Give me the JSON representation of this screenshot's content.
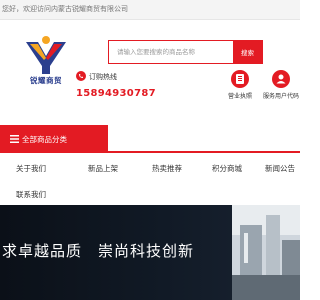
{
  "topbar": {
    "welcome": "您好，欢迎访问内蒙古锐耀商贸有限公司"
  },
  "logo": {
    "text": "锐耀商贸",
    "icon": "ry-logo-icon"
  },
  "search": {
    "placeholder": "请输入您要搜索的商品名称",
    "button_label": "搜索"
  },
  "hotline": {
    "label": "订购热线",
    "number": "15894930787",
    "icon": "phone-icon"
  },
  "badges": [
    {
      "label": "营业执照",
      "icon": "license-icon"
    },
    {
      "label": "服务用户代码",
      "icon": "user-card-icon"
    }
  ],
  "category": {
    "label": "全部商品分类",
    "icon": "menu-icon"
  },
  "nav": {
    "items": [
      {
        "label": "关于我们"
      },
      {
        "label": "新品上架"
      },
      {
        "label": "热卖推荐"
      },
      {
        "label": "积分商城"
      },
      {
        "label": "新闻公告"
      },
      {
        "label": "联系我们"
      }
    ]
  },
  "banner": {
    "slogan": "求卓越品质　崇尚科技创新"
  },
  "colors": {
    "accent": "#e31b23",
    "brand": "#2b3f8e"
  }
}
